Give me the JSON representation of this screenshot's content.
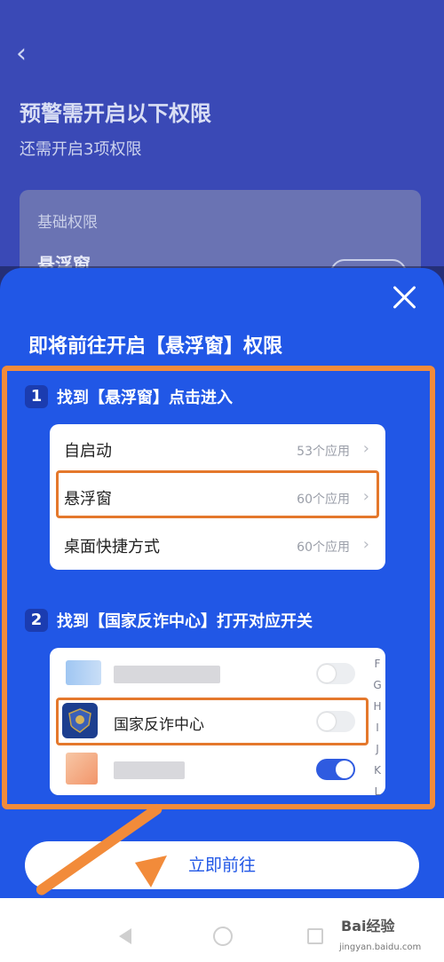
{
  "background": {
    "title": "预警需开启以下权限",
    "subtitle": "还需开启3项权限",
    "card_label": "基础权限",
    "card_item": "悬浮窗"
  },
  "sheet": {
    "title": "即将前往开启【悬浮窗】权限",
    "step1": {
      "number": "1",
      "text": "找到【悬浮窗】点击进入"
    },
    "step2": {
      "number": "2",
      "text": "找到【国家反诈中心】打开对应开关"
    },
    "settings_rows": [
      {
        "label": "自启动",
        "meta": "53个应用"
      },
      {
        "label": "悬浮窗",
        "meta": "60个应用"
      },
      {
        "label": "桌面快捷方式",
        "meta": "60个应用"
      }
    ],
    "app_rows": [
      {
        "name": "",
        "toggle": "off"
      },
      {
        "name": "国家反诈中心",
        "toggle": "off"
      },
      {
        "name": "",
        "toggle": "on"
      }
    ],
    "index_letters": [
      "F",
      "G",
      "H",
      "I",
      "J",
      "K",
      "L"
    ],
    "go_button": "立即前往"
  },
  "watermark": {
    "brand": "Bai经验",
    "url": "jingyan.baidu.com"
  },
  "colors": {
    "sheet_blue": "#2157e6",
    "highlight_orange": "#f28b3a",
    "toggle_on": "#2f5be0"
  }
}
